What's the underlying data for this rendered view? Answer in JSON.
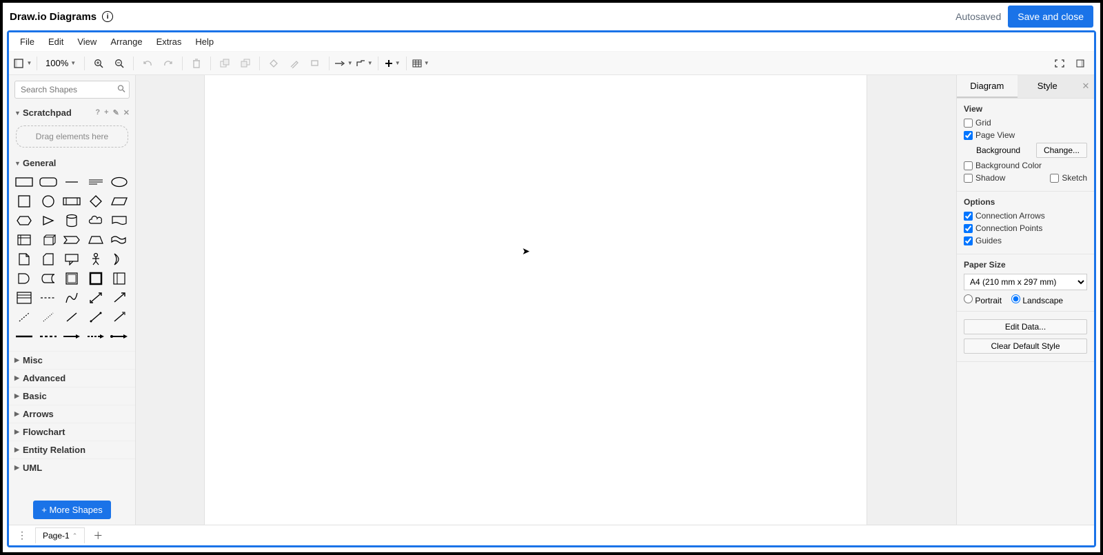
{
  "app": {
    "title": "Draw.io Diagrams",
    "autosaved": "Autosaved",
    "save_close": "Save and close"
  },
  "menu": {
    "file": "File",
    "edit": "Edit",
    "view": "View",
    "arrange": "Arrange",
    "extras": "Extras",
    "help": "Help"
  },
  "toolbar": {
    "zoom": "100%"
  },
  "sidebar": {
    "search_placeholder": "Search Shapes",
    "scratchpad": "Scratchpad",
    "dropzone": "Drag elements here",
    "general": "General",
    "misc": "Misc",
    "advanced": "Advanced",
    "basic": "Basic",
    "arrows": "Arrows",
    "flowchart": "Flowchart",
    "entity": "Entity Relation",
    "uml": "UML",
    "more_shapes": "+  More Shapes"
  },
  "right": {
    "tab_diagram": "Diagram",
    "tab_style": "Style",
    "view_hdr": "View",
    "grid": "Grid",
    "page_view": "Page View",
    "background": "Background",
    "change": "Change...",
    "background_color": "Background Color",
    "shadow": "Shadow",
    "sketch": "Sketch",
    "options_hdr": "Options",
    "conn_arrows": "Connection Arrows",
    "conn_points": "Connection Points",
    "guides": "Guides",
    "paper_hdr": "Paper Size",
    "paper_val": "A4 (210 mm x 297 mm)",
    "portrait": "Portrait",
    "landscape": "Landscape",
    "edit_data": "Edit Data...",
    "clear_style": "Clear Default Style"
  },
  "bottom": {
    "page1": "Page-1"
  }
}
